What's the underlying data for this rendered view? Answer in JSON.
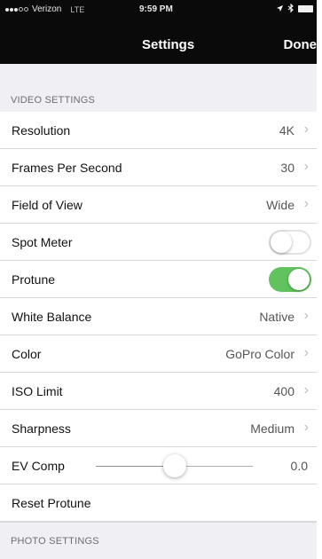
{
  "status_bar": {
    "carrier": "Verizon",
    "network": "LTE",
    "time": "9:59 PM"
  },
  "nav": {
    "title": "Settings",
    "done_label": "Done"
  },
  "video_settings": {
    "header": "VIDEO SETTINGS",
    "rows": [
      {
        "label": "Resolution",
        "value": "4K"
      },
      {
        "label": "Frames Per Second",
        "value": "30"
      },
      {
        "label": "Field of View",
        "value": "Wide"
      },
      {
        "label": "Spot Meter",
        "toggle": false
      },
      {
        "label": "Protune",
        "toggle": true
      },
      {
        "label": "White Balance",
        "value": "Native"
      },
      {
        "label": "Color",
        "value": "GoPro Color"
      },
      {
        "label": "ISO Limit",
        "value": "400"
      },
      {
        "label": "Sharpness",
        "value": "Medium"
      },
      {
        "label": "EV Comp",
        "value": "0.0",
        "slider_fraction": 0.5
      },
      {
        "label": "Reset Protune"
      }
    ]
  },
  "photo_settings": {
    "header": "PHOTO SETTINGS"
  },
  "colors": {
    "toggle_on": "#61c35d",
    "nav_background": "#0a0a0a",
    "group_background": "#efeff4"
  },
  "icons": {
    "chevron": "›"
  }
}
